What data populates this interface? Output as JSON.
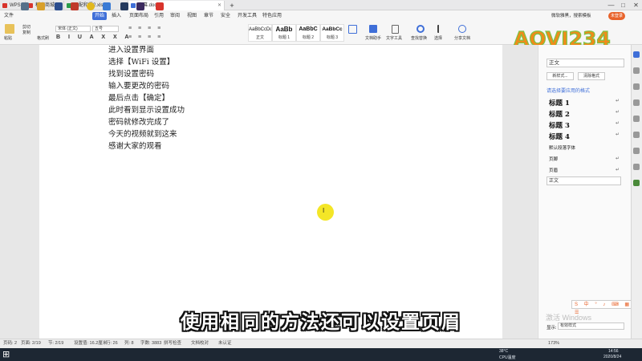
{
  "tabs": [
    {
      "label": "WPS",
      "color": "#d8342c"
    },
    {
      "label": "稻壳商城",
      "color": "#d8342c"
    },
    {
      "label": "退配和授2.xlsx",
      "color": "#2a9a4a"
    },
    {
      "label": "字幕.docx",
      "color": "#3f6fd8"
    }
  ],
  "window": {
    "user": "微软雅黑，搜索模板",
    "badge": "未登录",
    "min": "—",
    "max": "□",
    "close": "✕"
  },
  "menus": [
    "文件",
    "开始",
    "插入",
    "页面布局",
    "引用",
    "审阅",
    "视图",
    "章节",
    "安全",
    "开发工具",
    "特色应用"
  ],
  "ribbon": {
    "paste": "粘贴",
    "cut": "剪切",
    "copy": "复制",
    "format_painter": "格式刷",
    "font": "宋体 (正文)",
    "size": "五号",
    "find": "查找替换",
    "select": "选择",
    "share": "分享文档",
    "doc_helper": "文档助手",
    "text_tools": "文字工具"
  },
  "styles": [
    {
      "preview": "AaBbCcDd",
      "name": "正文"
    },
    {
      "preview": "AaBb",
      "name": "标题 1"
    },
    {
      "preview": "AaBbC",
      "name": "标题 2"
    },
    {
      "preview": "AaBbCc",
      "name": "标题 3"
    }
  ],
  "document_lines": [
    "进入设置界面",
    "选择【WiFi 设置】",
    "找到设置密码",
    "输入要更改的密码",
    "最后点击【确定】",
    "此时看到显示设置成功",
    "密码就修改完成了",
    "今天的视频就到这来",
    "感谢大家的观看"
  ],
  "panel": {
    "current_style": "正文",
    "new_style": "新样式...",
    "clear_format": "清除格式",
    "header": "请选择要应用的格式",
    "styles": [
      "标题 1",
      "标题 2",
      "标题 3",
      "标题 4"
    ],
    "default_font": "默认段落字体",
    "footer_label": "页脚",
    "header_label": "页眉",
    "normal": "正文",
    "show_label": "显示:",
    "show_value": "有效样式"
  },
  "status": {
    "page": "页码: 2",
    "pages": "页面: 2/19",
    "section": "节: 2/19",
    "setting": "设置值: 16.2厘米",
    "line": "行: 26",
    "col": "列: 8",
    "words": "字数: 3883",
    "spell": "拼写检查",
    "proof": "文档校对",
    "auth": "未认证",
    "zoom": "173%"
  },
  "taskbar": {
    "temp": "38°C",
    "cpu": "CPU温度",
    "time": "14:56",
    "date": "2020/8/24"
  },
  "subtitle": "使用相同的方法还可以设置页眉",
  "watermark": "激活 Windows",
  "logo": "AOVI234",
  "colors": {
    "accent": "#3f6fd8",
    "logo_orange": "#f08b1a",
    "logo_green": "#7cc243"
  }
}
